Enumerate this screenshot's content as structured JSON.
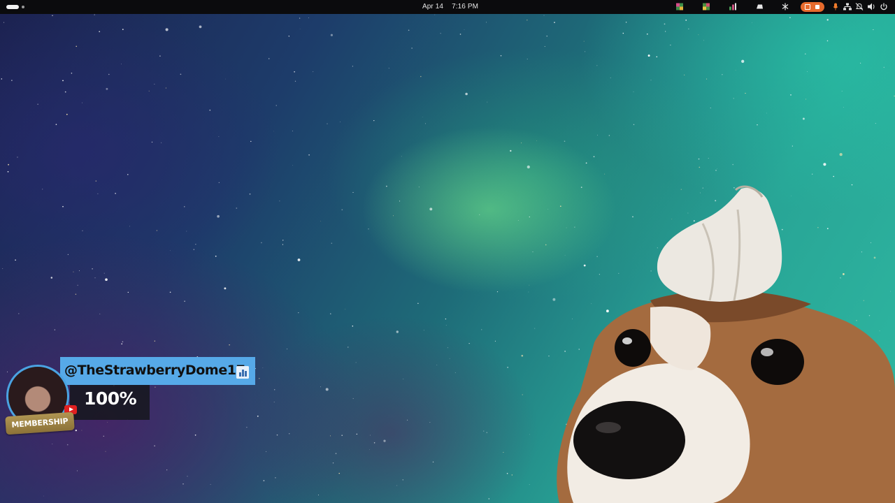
{
  "topbar": {
    "date": "Apr 14",
    "time": "7:16 PM",
    "tray_icons": [
      "app-icon-1",
      "app-icon-2",
      "app-icon-3",
      "drive-icon",
      "bluetooth-icon",
      "screen-record-icon",
      "microphone-icon",
      "network-icon",
      "notifications-off-icon",
      "volume-icon",
      "power-icon"
    ]
  },
  "overlay": {
    "handle": "@TheStrawberryDome17",
    "value": "100%",
    "membership_label": "MEMBERSHIP"
  },
  "colors": {
    "topbar": "#0b0b0d",
    "handle_box": "#56a9e8",
    "record_pill": "#e66a2c",
    "membership_badge": "#a48645"
  }
}
